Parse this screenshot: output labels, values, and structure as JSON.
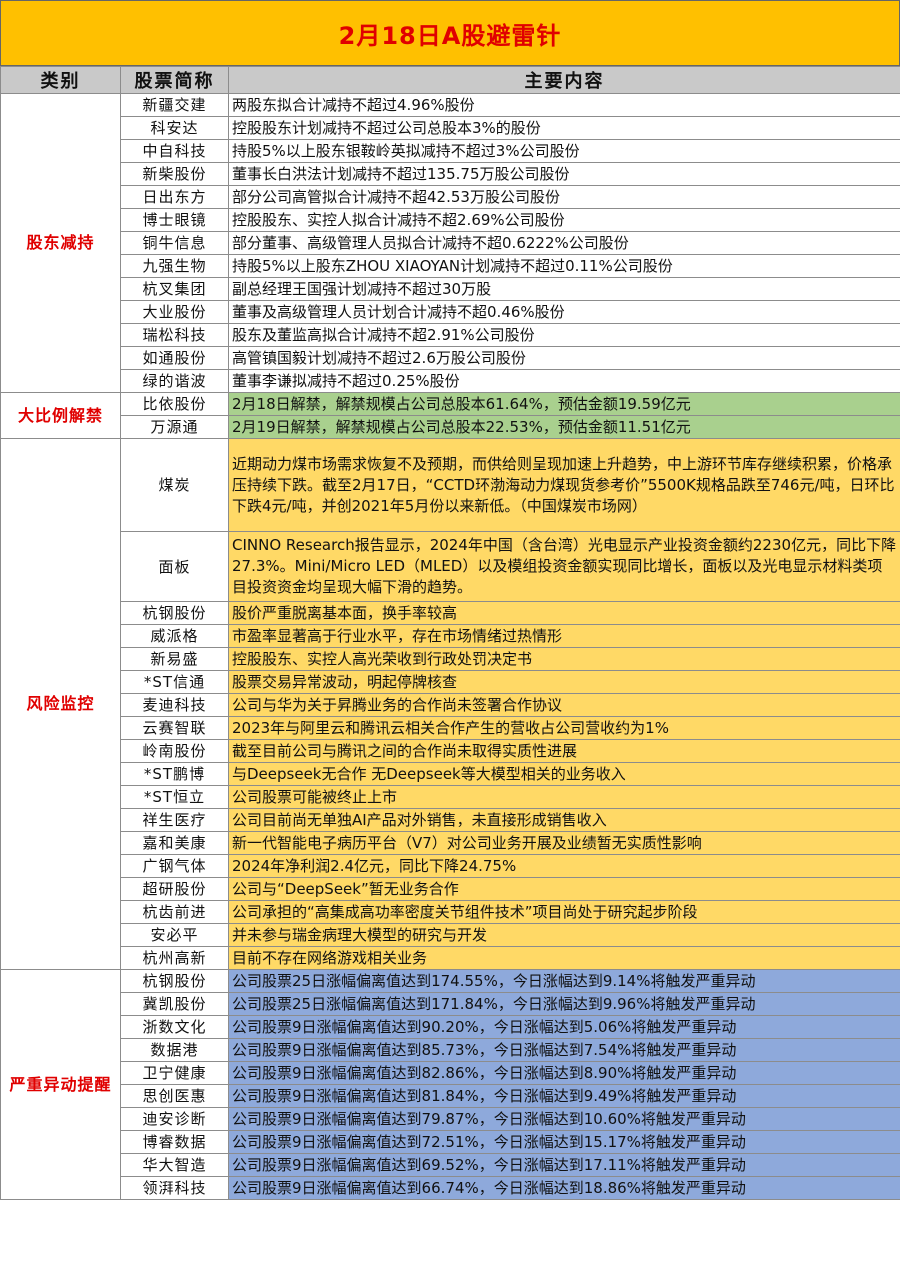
{
  "title": "2月18日A股避雷针",
  "headers": {
    "category": "类别",
    "stock": "股票简称",
    "content": "主要内容"
  },
  "groups": [
    {
      "category": "股东减持",
      "rows": [
        {
          "name": "新疆交建",
          "content": "两股东拟合计减持不超过4.96%股份"
        },
        {
          "name": "科安达",
          "content": "控股股东计划减持不超过公司总股本3%的股份"
        },
        {
          "name": "中自科技",
          "content": "持股5%以上股东银鞍岭英拟减持不超过3%公司股份"
        },
        {
          "name": "新柴股份",
          "content": "董事长白洪法计划减持不超过135.75万股公司股份"
        },
        {
          "name": "日出东方",
          "content": "部分公司高管拟合计减持不超42.53万股公司股份"
        },
        {
          "name": "博士眼镜",
          "content": "控股股东、实控人拟合计减持不超2.69%公司股份"
        },
        {
          "name": "铜牛信息",
          "content": "部分董事、高级管理人员拟合计减持不超0.6222%公司股份"
        },
        {
          "name": "九强生物",
          "content": "持股5%以上股东ZHOU XIAOYAN计划减持不超过0.11%公司股份"
        },
        {
          "name": "杭叉集团",
          "content": "副总经理王国强计划减持不超过30万股"
        },
        {
          "name": "大业股份",
          "content": "董事及高级管理人员计划合计减持不超0.46%股份"
        },
        {
          "name": "瑞松科技",
          "content": "股东及董监高拟合计减持不超2.91%公司股份"
        },
        {
          "name": "如通股份",
          "content": "高管镇国毅计划减持不超过2.6万股公司股份"
        },
        {
          "name": "绿的谐波",
          "content": "董事李谦拟减持不超过0.25%股份"
        }
      ]
    },
    {
      "category": "大比例解禁",
      "rows": [
        {
          "name": "比依股份",
          "content": "2月18日解禁，解禁规模占公司总股本61.64%，预估金额19.59亿元"
        },
        {
          "name": "万源通",
          "content": "2月19日解禁，解禁规模占公司总股本22.53%，预估金额11.51亿元"
        }
      ]
    },
    {
      "category": "风险监控",
      "rows": [
        {
          "name": "煤炭",
          "content": "近期动力煤市场需求恢复不及预期，而供给则呈现加速上升趋势，中上游环节库存继续积累，价格承压持续下跌。截至2月17日，“CCTD环渤海动力煤现货参考价”5500K规格品跌至746元/吨，日环比下跌4元/吨，并创2021年5月份以来新低。（中国煤炭市场网）"
        },
        {
          "name": "面板",
          "content": "CINNO Research报告显示，2024年中国（含台湾）光电显示产业投资金额约2230亿元，同比下降27.3%。Mini/Micro LED（MLED）以及模组投资金额实现同比增长，面板以及光电显示材料类项目投资资金均呈现大幅下滑的趋势。"
        },
        {
          "name": "杭钢股份",
          "content": "股价严重脱离基本面，换手率较高"
        },
        {
          "name": "威派格",
          "content": "市盈率显著高于行业水平，存在市场情绪过热情形"
        },
        {
          "name": "新易盛",
          "content": "控股股东、实控人高光荣收到行政处罚决定书"
        },
        {
          "name": "*ST信通",
          "content": "股票交易异常波动，明起停牌核查"
        },
        {
          "name": "麦迪科技",
          "content": "公司与华为关于昇腾业务的合作尚未签署合作协议"
        },
        {
          "name": "云赛智联",
          "content": "2023年与阿里云和腾讯云相关合作产生的营收占公司营收约为1%"
        },
        {
          "name": "岭南股份",
          "content": "截至目前公司与腾讯之间的合作尚未取得实质性进展"
        },
        {
          "name": "*ST鹏博",
          "content": "与Deepseek无合作 无Deepseek等大模型相关的业务收入"
        },
        {
          "name": "*ST恒立",
          "content": "公司股票可能被终止上市"
        },
        {
          "name": "祥生医疗",
          "content": "公司目前尚无单独AI产品对外销售，未直接形成销售收入"
        },
        {
          "name": "嘉和美康",
          "content": "新一代智能电子病历平台（V7）对公司业务开展及业绩暂无实质性影响"
        },
        {
          "name": "广钢气体",
          "content": "2024年净利润2.4亿元，同比下降24.75%"
        },
        {
          "name": "超研股份",
          "content": "公司与“DeepSeek”暂无业务合作"
        },
        {
          "name": "杭齿前进",
          "content": "公司承担的“高集成高功率密度关节组件技术”项目尚处于研究起步阶段"
        },
        {
          "name": "安必平",
          "content": "并未参与瑞金病理大模型的研究与开发"
        },
        {
          "name": "杭州高新",
          "content": "目前不存在网络游戏相关业务"
        }
      ]
    },
    {
      "category": "严重异动提醒",
      "rows": [
        {
          "name": "杭钢股份",
          "content": "公司股票25日涨幅偏离值达到174.55%，今日涨幅达到9.14%将触发严重异动"
        },
        {
          "name": "冀凯股份",
          "content": "公司股票25日涨幅偏离值达到171.84%，今日涨幅达到9.96%将触发严重异动"
        },
        {
          "name": "浙数文化",
          "content": "公司股票9日涨幅偏离值达到90.20%，今日涨幅达到5.06%将触发严重异动"
        },
        {
          "name": "数据港",
          "content": "公司股票9日涨幅偏离值达到85.73%，今日涨幅达到7.54%将触发严重异动"
        },
        {
          "name": "卫宁健康",
          "content": "公司股票9日涨幅偏离值达到82.86%，今日涨幅达到8.90%将触发严重异动"
        },
        {
          "name": "思创医惠",
          "content": "公司股票9日涨幅偏离值达到81.84%，今日涨幅达到9.49%将触发严重异动"
        },
        {
          "name": "迪安诊断",
          "content": "公司股票9日涨幅偏离值达到79.87%，今日涨幅达到10.60%将触发严重异动"
        },
        {
          "name": "博睿数据",
          "content": "公司股票9日涨幅偏离值达到72.51%，今日涨幅达到15.17%将触发严重异动"
        },
        {
          "name": "华大智造",
          "content": "公司股票9日涨幅偏离值达到69.52%，今日涨幅达到17.11%将触发严重异动"
        },
        {
          "name": "领湃科技",
          "content": "公司股票9日涨幅偏离值达到66.74%，今日涨幅达到18.86%将触发严重异动"
        }
      ]
    }
  ]
}
